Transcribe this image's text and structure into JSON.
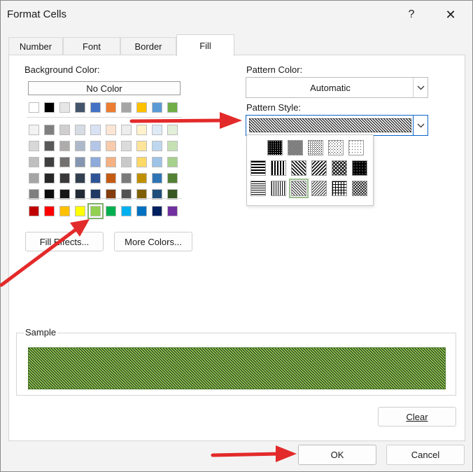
{
  "window": {
    "title": "Format Cells",
    "help_glyph": "?",
    "close_glyph": "✕"
  },
  "tabs": [
    {
      "label": "Number",
      "active": false
    },
    {
      "label": "Font",
      "active": false
    },
    {
      "label": "Border",
      "active": false
    },
    {
      "label": "Fill",
      "active": true
    }
  ],
  "background": {
    "label": "Background Color:",
    "no_color_label": "No Color",
    "theme_top_row": [
      "#FFFFFF",
      "#000000",
      "#E7E6E6",
      "#44546A",
      "#4472C4",
      "#ED7D31",
      "#A5A5A5",
      "#FFC000",
      "#5B9BD5",
      "#70AD47"
    ],
    "theme_shades": [
      [
        "#F2F2F2",
        "#7F7F7F",
        "#D0CECE",
        "#D6DCE4",
        "#D9E2F3",
        "#FBE5D5",
        "#EDEDED",
        "#FFF2CC",
        "#DEEBF6",
        "#E2EFD9"
      ],
      [
        "#D8D8D8",
        "#595959",
        "#AEABAB",
        "#ADB9CA",
        "#B4C6E7",
        "#F7CBAC",
        "#DBDBDB",
        "#FEE599",
        "#BDD7EE",
        "#C5E0B3"
      ],
      [
        "#BFBFBF",
        "#3F3F3F",
        "#757070",
        "#8496B0",
        "#8EAADB",
        "#F4B183",
        "#C9C9C9",
        "#FFD965",
        "#9DC3E6",
        "#A8D08D"
      ],
      [
        "#A5A5A5",
        "#262626",
        "#3A3838",
        "#323F4F",
        "#2F5496",
        "#C55A11",
        "#7B7B7B",
        "#BF8F00",
        "#2E75B5",
        "#538135"
      ],
      [
        "#7F7F7F",
        "#0C0C0C",
        "#171616",
        "#222A35",
        "#1F3864",
        "#833C0B",
        "#525252",
        "#7F6000",
        "#1E4E79",
        "#375623"
      ]
    ],
    "standard_row": [
      "#C00000",
      "#FF0000",
      "#FFC000",
      "#FFFF00",
      "#92D050",
      "#00B050",
      "#00B0F0",
      "#0070C0",
      "#002060",
      "#7030A0"
    ],
    "selected_standard_index": 4,
    "fill_effects_label": "Fill Effects...",
    "more_colors_label": "More Colors..."
  },
  "pattern": {
    "color_label": "Pattern Color:",
    "color_value": "Automatic",
    "style_label": "Pattern Style:",
    "styles": [
      "solid",
      "75-gray",
      "50-gray",
      "25-gray",
      "12-gray",
      "6-gray",
      "horizontal-stripe",
      "vertical-stripe",
      "reverse-diagonal-stripe",
      "diagonal-stripe",
      "diagonal-crosshatch",
      "thick-diagonal-crosshatch",
      "thin-horizontal-stripe",
      "thin-vertical-stripe",
      "thin-reverse-diagonal-stripe",
      "thin-diagonal-stripe",
      "thin-horizontal-crosshatch",
      "thin-diagonal-crosshatch"
    ],
    "selected_style_index": 14
  },
  "sample": {
    "label": "Sample",
    "fill_color": "#92D050",
    "pattern_color": "#1a1a1a"
  },
  "buttons": {
    "clear": "Clear",
    "ok": "OK",
    "cancel": "Cancel"
  },
  "annotation_color": "#E32A2A"
}
